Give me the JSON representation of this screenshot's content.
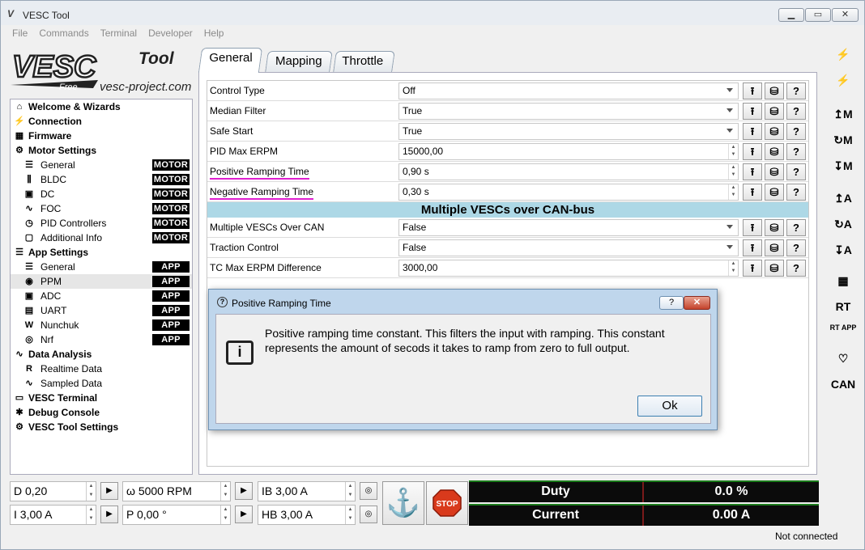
{
  "window": {
    "title": "VESC Tool",
    "min": "▁",
    "max": "▭",
    "close": "✕"
  },
  "menu": [
    "File",
    "Commands",
    "Terminal",
    "Developer",
    "Help"
  ],
  "logo": {
    "main": "VESC",
    "tool": "Tool",
    "free": "Free",
    "site": "vesc-project.com"
  },
  "nav": [
    {
      "label": "Welcome & Wizards",
      "level": "top",
      "icon": "⌂",
      "badge": ""
    },
    {
      "label": "Connection",
      "level": "top",
      "icon": "⚡",
      "badge": ""
    },
    {
      "label": "Firmware",
      "level": "top",
      "icon": "▦",
      "badge": ""
    },
    {
      "label": "Motor Settings",
      "level": "top",
      "icon": "⚙",
      "badge": ""
    },
    {
      "label": "General",
      "level": "sub",
      "icon": "☰",
      "badge": "MOTOR"
    },
    {
      "label": "BLDC",
      "level": "sub",
      "icon": "⫼",
      "badge": "MOTOR"
    },
    {
      "label": "DC",
      "level": "sub",
      "icon": "▣",
      "badge": "MOTOR"
    },
    {
      "label": "FOC",
      "level": "sub",
      "icon": "∿",
      "badge": "MOTOR"
    },
    {
      "label": "PID Controllers",
      "level": "sub",
      "icon": "◷",
      "badge": "MOTOR"
    },
    {
      "label": "Additional Info",
      "level": "sub",
      "icon": "▢",
      "badge": "MOTOR"
    },
    {
      "label": "App Settings",
      "level": "top",
      "icon": "☰",
      "badge": ""
    },
    {
      "label": "General",
      "level": "sub",
      "icon": "☰",
      "badge": "APP"
    },
    {
      "label": "PPM",
      "level": "sub",
      "icon": "◉",
      "badge": "APP",
      "selected": true
    },
    {
      "label": "ADC",
      "level": "sub",
      "icon": "▣",
      "badge": "APP"
    },
    {
      "label": "UART",
      "level": "sub",
      "icon": "▤",
      "badge": "APP"
    },
    {
      "label": "Nunchuk",
      "level": "sub",
      "icon": "W",
      "badge": "APP"
    },
    {
      "label": "Nrf",
      "level": "sub",
      "icon": "◎",
      "badge": "APP"
    },
    {
      "label": "Data Analysis",
      "level": "top",
      "icon": "∿",
      "badge": ""
    },
    {
      "label": "Realtime Data",
      "level": "sub",
      "icon": "R",
      "badge": ""
    },
    {
      "label": "Sampled Data",
      "level": "sub",
      "icon": "∿",
      "badge": ""
    },
    {
      "label": "VESC Terminal",
      "level": "top",
      "icon": "▭",
      "badge": ""
    },
    {
      "label": "Debug Console",
      "level": "top",
      "icon": "✱",
      "badge": ""
    },
    {
      "label": "VESC Tool Settings",
      "level": "top",
      "icon": "⚙",
      "badge": ""
    }
  ],
  "tabs": [
    {
      "label": "General",
      "active": true
    },
    {
      "label": "Mapping",
      "active": false
    },
    {
      "label": "Throttle Curve",
      "active": false
    }
  ],
  "params": [
    {
      "label": "Control Type",
      "value": "Off",
      "kind": "combo",
      "underline": false
    },
    {
      "label": "Median Filter",
      "value": "True",
      "kind": "combo",
      "underline": false
    },
    {
      "label": "Safe Start",
      "value": "True",
      "kind": "combo",
      "underline": false
    },
    {
      "label": "PID Max ERPM",
      "value": "15000,00",
      "kind": "spin",
      "underline": false
    },
    {
      "label": "Positive Ramping Time",
      "value": "0,90 s",
      "kind": "spin",
      "underline": true
    },
    {
      "label": "Negative Ramping Time",
      "value": "0,30 s",
      "kind": "spin",
      "underline": true
    }
  ],
  "section_title": "Multiple VESCs over CAN-bus",
  "params2": [
    {
      "label": "Multiple VESCs Over CAN",
      "value": "False",
      "kind": "combo"
    },
    {
      "label": "Traction Control",
      "value": "False",
      "kind": "combo"
    },
    {
      "label": "TC Max ERPM Difference",
      "value": "3000,00",
      "kind": "spin"
    }
  ],
  "row_buttons": {
    "upload": "⭱",
    "db": "⛁",
    "help": "?"
  },
  "dialog": {
    "title": "Positive Ramping Time",
    "help_btn": "?",
    "close_btn": "✕",
    "message": "Positive ramping time constant. This filters the input with ramping. This constant represents the amount of secods it takes to ramp from zero to full output.",
    "icon": "i",
    "ok": "Ok"
  },
  "right_toolbar": [
    "⚡",
    "⚡",
    "↥M",
    "↻M",
    "↧M",
    "↥A",
    "↻A",
    "↧A",
    "▦",
    "RT",
    "RT APP",
    "♡",
    "CAN"
  ],
  "bottom": {
    "d": "D 0,20",
    "omega": "ω 5000 RPM",
    "ib": "IB 3,00 A",
    "i": "I 3,00 A",
    "p": "P 0,00 °",
    "hb": "HB 3,00 A",
    "play": "▶",
    "hold": "◎",
    "anchor": "⚓",
    "stop": "STOP"
  },
  "gauges": [
    {
      "label": "Duty",
      "value": "0.0 %"
    },
    {
      "label": "Current",
      "value": "0.00 A"
    }
  ],
  "status": "Not connected",
  "colors": {
    "section": "#add8e6",
    "underline": "#e020d0",
    "badge": "#000000",
    "stop": "#d93a1c"
  }
}
